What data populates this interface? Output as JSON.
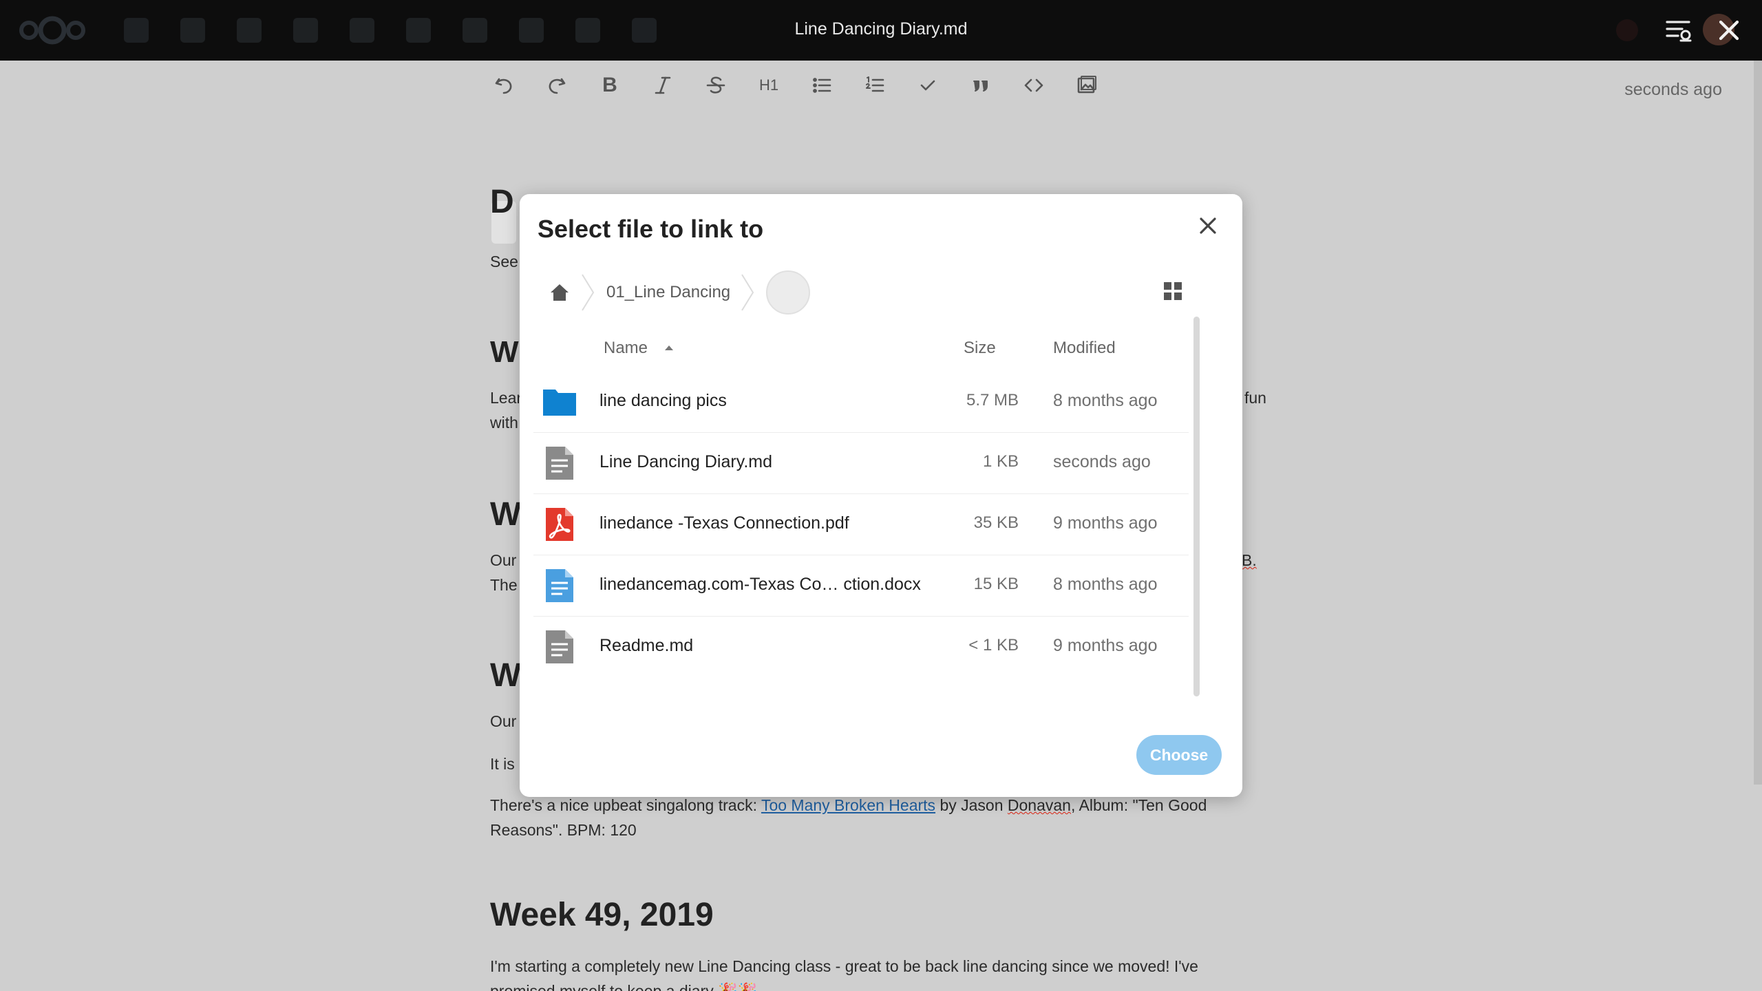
{
  "header": {
    "document_title": "Line Dancing Diary.md",
    "icons": [
      "nextcloud-logo",
      "app-icons",
      "sidebar-toggle-icon",
      "avatar",
      "close-icon"
    ]
  },
  "toolbar": {
    "buttons": [
      "undo",
      "redo",
      "bold",
      "italic",
      "strikethrough",
      "H1",
      "bullet-list",
      "ordered-list",
      "checklist",
      "blockquote",
      "code",
      "image"
    ],
    "bold_label": "B",
    "h1_label": "H1",
    "save_status": "seconds ago"
  },
  "document": {
    "heading_1_fragment": "D",
    "para_1_fragment": "See",
    "heading_2_fragment": "W",
    "para_2a_fragment": "Lear",
    "para_2a_right": "fun",
    "para_2b_fragment": "with",
    "heading_3_fragment": "W",
    "para_3a_fragment": "Our",
    "para_3a_right": "B.",
    "para_3b_fragment": "The",
    "heading_4_fragment": "W",
    "para_4_fragment": "Our",
    "para_5_fragment": "It is",
    "track_line_prefix": "There's a nice upbeat singalong track: ",
    "track_link": "Too Many Broken Hearts",
    "track_line_mid": " by Jason ",
    "track_artist_last": "Donavan",
    "track_line_suffix": ", Album: \"Ten Good",
    "track_line_2": "Reasons\". BPM: 120",
    "week_heading": "Week 49, 2019",
    "week_para_1": "I'm starting a completely new Line Dancing class - great to be back line dancing since we moved! I've",
    "week_para_2": "promised myself to keep a diary 🎉🎉"
  },
  "modal": {
    "title": "Select file to link to",
    "breadcrumb": [
      "01_Line Dancing"
    ],
    "columns": {
      "name": "Name",
      "size": "Size",
      "modified": "Modified"
    },
    "files": [
      {
        "name": "line dancing pics",
        "size": "5.7 MB",
        "modified": "8 months ago",
        "icon": "folder-icon"
      },
      {
        "name": "Line Dancing Diary.md",
        "size": "1 KB",
        "modified": "seconds ago",
        "icon": "text-file-icon"
      },
      {
        "name": "linedance -Texas Connection.pdf",
        "size": "35 KB",
        "modified": "9 months ago",
        "icon": "pdf-icon"
      },
      {
        "name": "linedancemag.com-Texas Co… ction.docx",
        "size": "15 KB",
        "modified": "8 months ago",
        "icon": "docx-icon"
      },
      {
        "name": "Readme.md",
        "size": "< 1 KB",
        "modified": "9 months ago",
        "icon": "text-file-icon"
      }
    ],
    "choose_label": "Choose"
  },
  "colors": {
    "header_bg": "#0d0d0d",
    "backdrop": "#cfcfcf",
    "folder_blue": "#0f82d0",
    "pdf_red": "#e3392c",
    "docx_blue": "#4a9fe0",
    "text_gray": "#8a8a8a",
    "choose_button": "#8fc8ef"
  }
}
